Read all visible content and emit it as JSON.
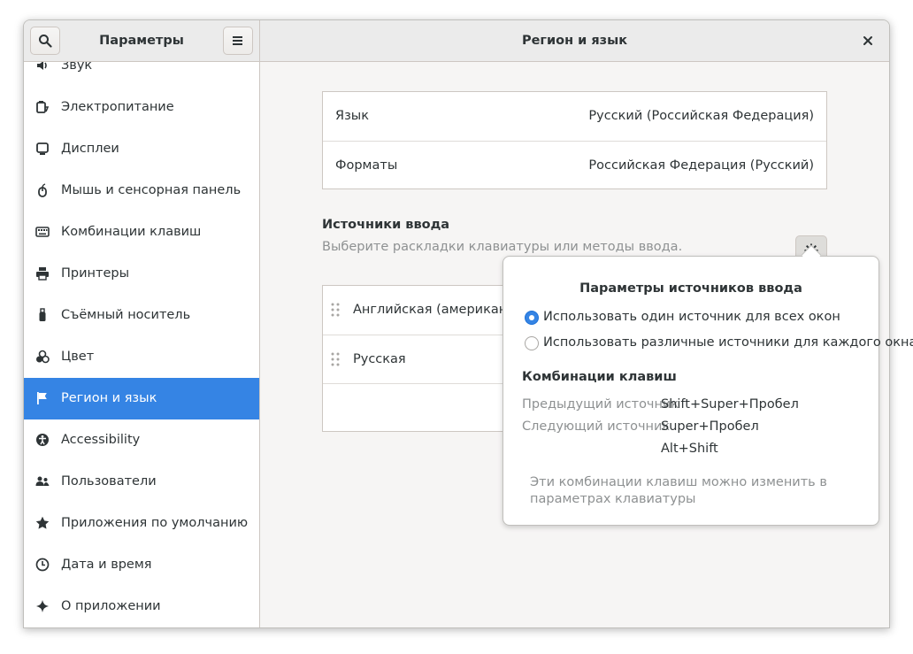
{
  "header": {
    "app_title": "Параметры",
    "page_title": "Регион и язык"
  },
  "sidebar": {
    "items": [
      {
        "label": "Звук",
        "icon": "speaker-icon"
      },
      {
        "label": "Электропитание",
        "icon": "power-icon"
      },
      {
        "label": "Дисплеи",
        "icon": "display-icon"
      },
      {
        "label": "Мышь и сенсорная панель",
        "icon": "mouse-icon"
      },
      {
        "label": "Комбинации клавиш",
        "icon": "keyboard-icon"
      },
      {
        "label": "Принтеры",
        "icon": "printer-icon"
      },
      {
        "label": "Съёмный носитель",
        "icon": "usb-drive-icon"
      },
      {
        "label": "Цвет",
        "icon": "color-icon"
      },
      {
        "label": "Регион и язык",
        "icon": "flag-icon",
        "active": true
      },
      {
        "label": "Accessibility",
        "icon": "accessibility-icon"
      },
      {
        "label": "Пользователи",
        "icon": "users-icon"
      },
      {
        "label": "Приложения по умолчанию",
        "icon": "star-icon"
      },
      {
        "label": "Дата и время",
        "icon": "clock-icon"
      },
      {
        "label": "О приложении",
        "icon": "sparkle-icon"
      }
    ]
  },
  "language_card": {
    "language_label": "Язык",
    "language_value": "Русский (Российская Федерация)",
    "formats_label": "Форматы",
    "formats_value": "Российская Федерация (Русский)"
  },
  "input_sources": {
    "title": "Источники ввода",
    "subtitle": "Выберите раскладки клавиатуры или методы ввода.",
    "sources": [
      {
        "label": "Английская (американска"
      },
      {
        "label": "Русская"
      }
    ]
  },
  "popover": {
    "title": "Параметры источников ввода",
    "option_same": "Использовать один источник для всех окон",
    "option_different": "Использовать различные источники для каждого окна",
    "selected": "option_same",
    "shortcuts_title": "Комбинации клавиш",
    "prev_label": "Предыдущий источник",
    "prev_value": "Shift+Super+Пробел",
    "next_label": "Следующий источник",
    "next_value": "Super+Пробел",
    "next_value_alt": "Alt+Shift",
    "note": "Эти комбинации клавиш можно изменить в параметрах клавиатуры"
  },
  "colors": {
    "accent": "#3584e4",
    "window_bg": "#f6f5f4",
    "header_bg": "#ebebeb",
    "border": "#cdc7c2"
  }
}
